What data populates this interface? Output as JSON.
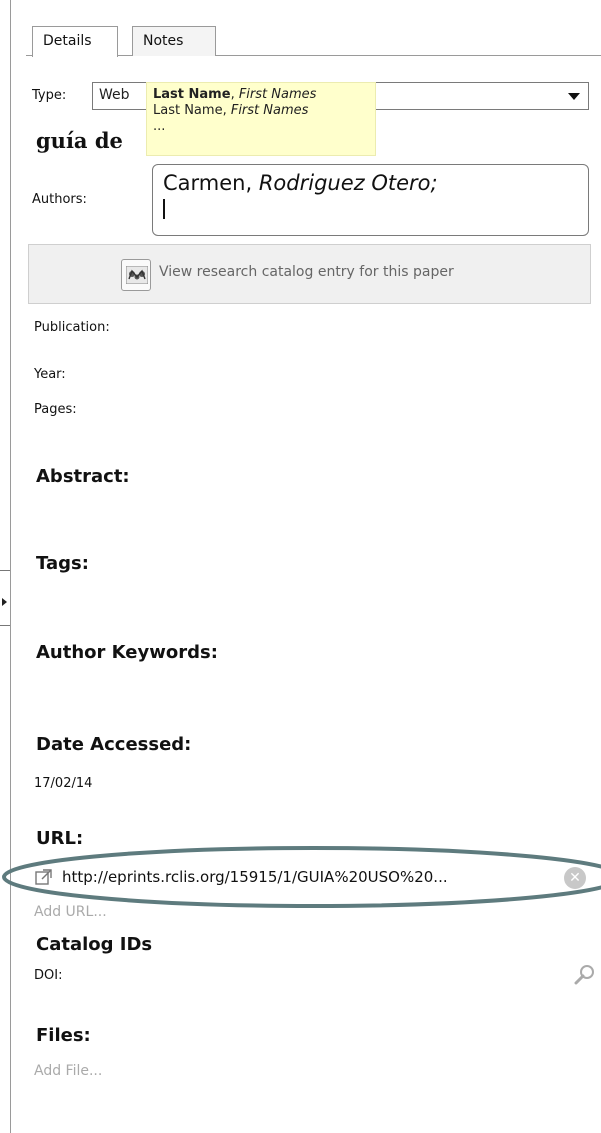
{
  "tabs": [
    {
      "label": "Details",
      "active": true
    },
    {
      "label": "Notes",
      "active": false
    }
  ],
  "type": {
    "label": "Type:",
    "value": "Web"
  },
  "tooltip": {
    "line1_bold": "Last Name",
    "line1_sep": ", ",
    "line1_italic": "First Names",
    "line2_plain": "Last Name, ",
    "line2_italic": "First Names",
    "line3": "..."
  },
  "document": {
    "title_partial": "guía de"
  },
  "authors": {
    "label": "Authors:",
    "value_name": "Carmen, ",
    "value_italic": "Rodriguez Otero;"
  },
  "catalog_button": {
    "icon": "mendeley-catalog-icon",
    "label": "View research catalog entry for this paper"
  },
  "fields": {
    "publication": "Publication:",
    "year": "Year:",
    "pages": "Pages:"
  },
  "sections": {
    "abstract": "Abstract:",
    "tags": "Tags:",
    "author_keywords": "Author Keywords:",
    "date_accessed": "Date Accessed:",
    "url": "URL:",
    "catalog_ids": "Catalog IDs",
    "files": "Files:"
  },
  "date_accessed_value": "17/02/14",
  "url": {
    "value": "http://eprints.rclis.org/15915/1/GUIA%20USO%20...",
    "add_label": "Add URL...",
    "highlight_color": "#5e7b7e"
  },
  "catalog_ids": {
    "doi_label": "DOI:"
  },
  "files": {
    "add_label": "Add File..."
  },
  "colors": {
    "tooltip_bg": "#ffffcc",
    "button_bg": "#f0f0f0",
    "muted_text": "#aaaaaa"
  }
}
